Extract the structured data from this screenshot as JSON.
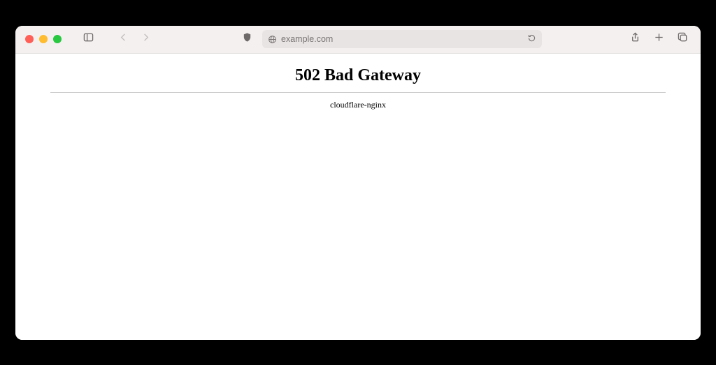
{
  "browser": {
    "address": "example.com"
  },
  "page": {
    "error_title": "502 Bad Gateway",
    "server_line": "cloudflare-nginx"
  }
}
